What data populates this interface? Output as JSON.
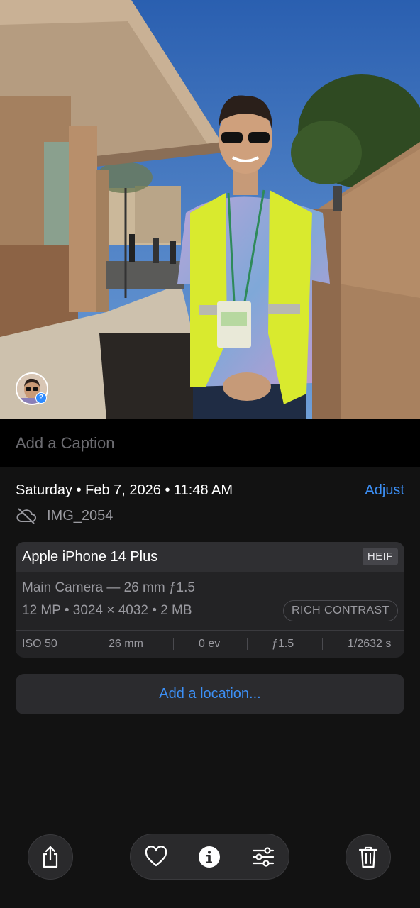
{
  "caption": {
    "placeholder": "Add a Caption"
  },
  "info": {
    "date_time": "Saturday • Feb 7, 2026 • 11:48 AM",
    "adjust_label": "Adjust",
    "filename": "IMG_2054"
  },
  "exif": {
    "device": "Apple iPhone 14 Plus",
    "format": "HEIF",
    "lens": "Main Camera — 26 mm ƒ1.5",
    "specs": "12 MP • 3024 × 4032 • 2 MB",
    "photo_style": "RICH CONTRAST",
    "iso": "ISO 50",
    "focal_length": "26 mm",
    "exposure_bias": "0 ev",
    "aperture": "ƒ1.5",
    "shutter": "1/2632 s"
  },
  "location": {
    "label": "Add a location..."
  },
  "toolbar": {
    "share_icon": "share-icon",
    "favorite_icon": "heart-icon",
    "info_icon": "info-icon",
    "edit_icon": "sliders-icon",
    "delete_icon": "trash-icon"
  },
  "colors": {
    "background": "#121212",
    "accent": "#3c8ff5",
    "card": "#232325"
  }
}
